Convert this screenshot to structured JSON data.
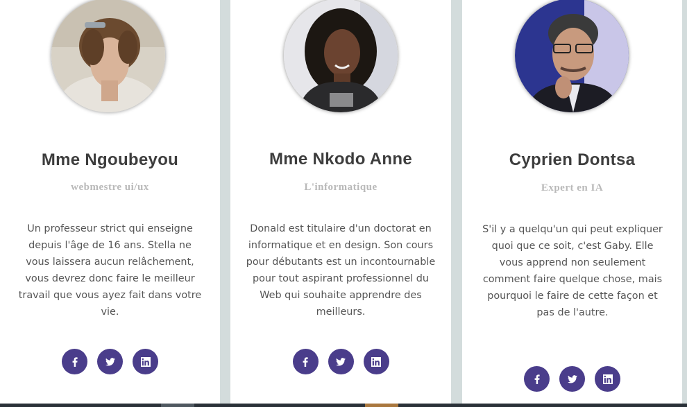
{
  "team": [
    {
      "name": "Mme Ngoubeyou",
      "role": "webmestre ui/ux",
      "bio": "Un professeur strict qui enseigne depuis l'âge de 16 ans. Stella ne vous laissera aucun relâchement, vous devrez donc faire le meilleur travail que vous ayez fait dans votre vie.",
      "socials": [
        "facebook-icon",
        "twitter-icon",
        "linkedin-icon"
      ]
    },
    {
      "name": "Mme Nkodo Anne",
      "role": "L'informatique",
      "bio": "Donald est titulaire d'un doctorat en informatique et en design. Son cours pour débutants est un incontournable pour tout aspirant professionnel du Web qui souhaite apprendre des meilleurs.",
      "socials": [
        "facebook-icon",
        "twitter-icon",
        "linkedin-icon"
      ]
    },
    {
      "name": "Cyprien Dontsa",
      "role": "Expert en IA",
      "bio": "S'il y a quelqu'un qui peut expliquer quoi que ce soit, c'est Gaby. Elle vous apprend non seulement comment faire quelque chose, mais pourquoi le faire de cette façon et pas de l'autre.",
      "socials": [
        "facebook-icon",
        "twitter-icon",
        "linkedin-icon"
      ]
    }
  ],
  "colors": {
    "accent": "#4a3d8b",
    "page_background": "#d3dcdc",
    "card_background": "#ffffff",
    "name_text": "#3d3d3d",
    "role_text": "#b9b9b9",
    "bio_text": "#555555"
  }
}
